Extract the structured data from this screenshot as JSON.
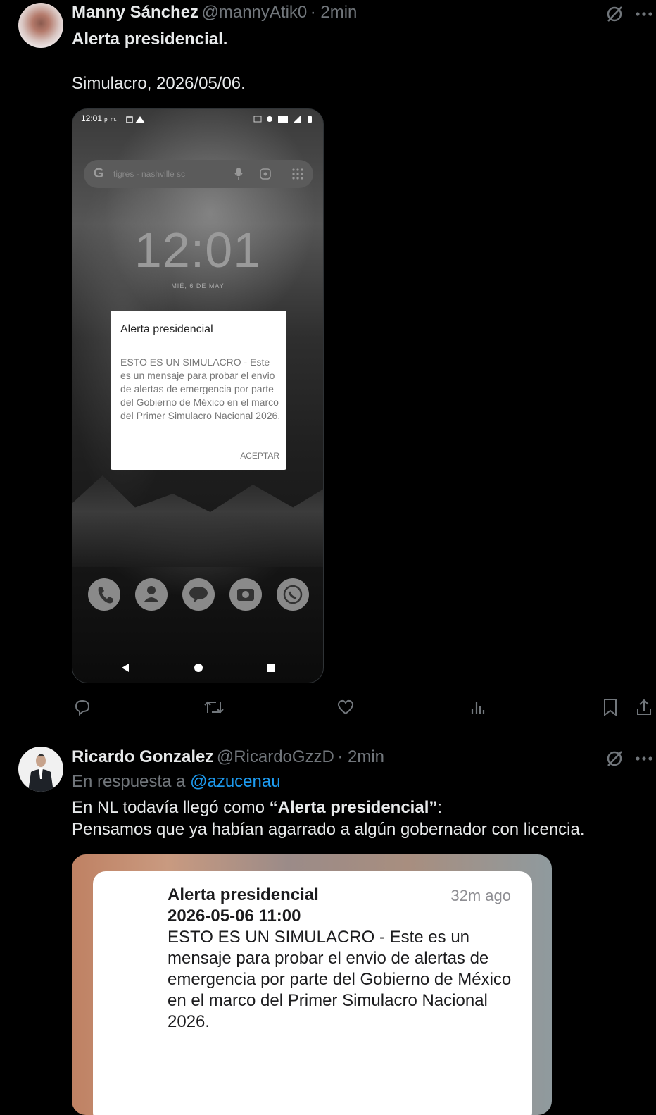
{
  "tweet1": {
    "display_name": "Manny Sánchez",
    "handle": "@mannyAtik0",
    "time": "· 2min",
    "text_line1": "Alerta presidencial.",
    "text_line2": "Simulacro, 2026/05/06.",
    "phone": {
      "status_time": "12:01",
      "status_ampm": "p. m.",
      "search_text": "tigres - nashville sc",
      "clock": "12:01",
      "date": "MIÉ, 6 DE MAY",
      "dialog_title": "Alerta presidencial",
      "dialog_body": "ESTO ES UN SIMULACRO - Este es un mensaje para probar el envio de alertas de emergencia por parte del Gobierno de México en el marco del Primer Simulacro Nacional 2026.",
      "dialog_button": "ACEPTAR"
    }
  },
  "tweet2": {
    "display_name": "Ricardo Gonzalez",
    "handle": "@RicardoGzzD",
    "time": "· 2min",
    "reply_prefix": "En respuesta a",
    "reply_to": "@azucenau",
    "text_pre": "En NL todavía llegó como ",
    "text_bold": "“Alerta presidencial”",
    "text_post": ":",
    "text_line2": "Pensamos que ya habían agarrado a algún gobernador con licencia.",
    "notification": {
      "title": "Alerta presidencial",
      "age": "32m ago",
      "datetime": "2026-05-06 11:00",
      "body": "ESTO ES UN SIMULACRO - Este es un mensaje para probar el envio de alertas de emergencia por parte del Gobierno de México en el marco del Primer Simulacro Nacional 2026."
    }
  },
  "colors": {
    "background": "#000000",
    "text": "#e7e9ea",
    "secondary": "#71767b",
    "link": "#1d9bf0"
  },
  "icons": [
    "grok-slash-icon",
    "more-icon",
    "reply-icon",
    "repost-icon",
    "like-icon",
    "views-icon",
    "bookmark-icon",
    "share-icon"
  ]
}
